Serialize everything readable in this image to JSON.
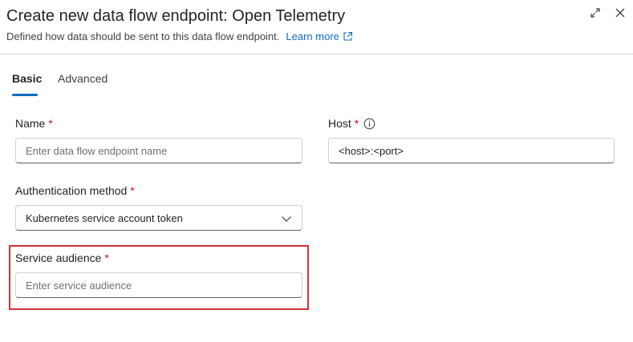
{
  "header": {
    "title": "Create new data flow endpoint: Open Telemetry",
    "subtitle": "Defined how data should be sent to this data flow endpoint.",
    "learn_more": "Learn more",
    "icons": [
      "expand-icon",
      "close-icon",
      "external-link-icon"
    ]
  },
  "tabs": [
    {
      "label": "Basic",
      "active": true
    },
    {
      "label": "Advanced",
      "active": false
    }
  ],
  "form": {
    "name": {
      "label": "Name",
      "required_mark": "*",
      "placeholder": "Enter data flow endpoint name"
    },
    "host": {
      "label": "Host",
      "required_mark": "*",
      "value": "<host>:<port>",
      "icon": "info-icon"
    },
    "auth": {
      "label": "Authentication method",
      "required_mark": "*",
      "value": "Kubernetes service account token",
      "icon": "chevron-down-icon"
    },
    "service_audience": {
      "label": "Service audience",
      "required_mark": "*",
      "placeholder": "Enter service audience"
    }
  },
  "colors": {
    "accent": "#0f6cbd",
    "required": "#c50f1f",
    "highlight_border": "#d13438"
  }
}
